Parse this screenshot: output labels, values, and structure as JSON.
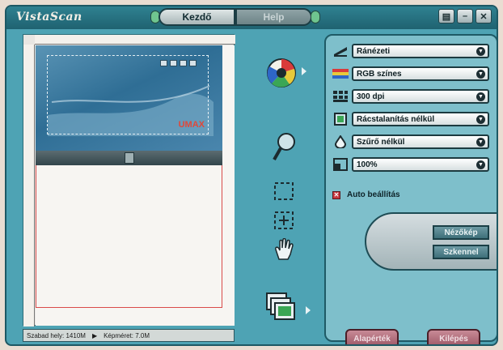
{
  "app": {
    "logo_text": "VistaScan"
  },
  "tabs": [
    {
      "label": "Kezdő"
    },
    {
      "label": "Help"
    }
  ],
  "window_buttons": {
    "menu": "▤",
    "minimize": "–",
    "close": "✕"
  },
  "preview": {
    "scan_brand": "UMAX"
  },
  "status": {
    "free_space": "Szabad hely: 1410M",
    "image_size": "Képméret: 7.0M"
  },
  "tools": [
    {
      "name": "color-wheel"
    },
    {
      "name": "magnifier"
    },
    {
      "name": "select-marquee"
    },
    {
      "name": "add-frame"
    },
    {
      "name": "hand"
    },
    {
      "name": "multi-page"
    }
  ],
  "settings": [
    {
      "label": "Ránézeti",
      "icon": "scanner-type-icon"
    },
    {
      "label": "RGB színes",
      "icon": "color-mode-icon"
    },
    {
      "label": "300 dpi",
      "icon": "resolution-icon"
    },
    {
      "label": "Rácstalanítás nélkül",
      "icon": "descreen-icon"
    },
    {
      "label": "Szűrő nélkül",
      "icon": "filter-icon"
    },
    {
      "label": "100%",
      "icon": "scale-icon"
    }
  ],
  "auto_setting": {
    "label": "Auto beállítás",
    "checked": true
  },
  "actions": {
    "preview": "Nézőkép",
    "scan": "Szkennel"
  },
  "bottom": {
    "left": "Alapérték",
    "right": "Kilépés"
  },
  "colors": {
    "window": "#4ea3b4",
    "panel": "#7ebfcb",
    "accent_red": "#c7383f"
  }
}
